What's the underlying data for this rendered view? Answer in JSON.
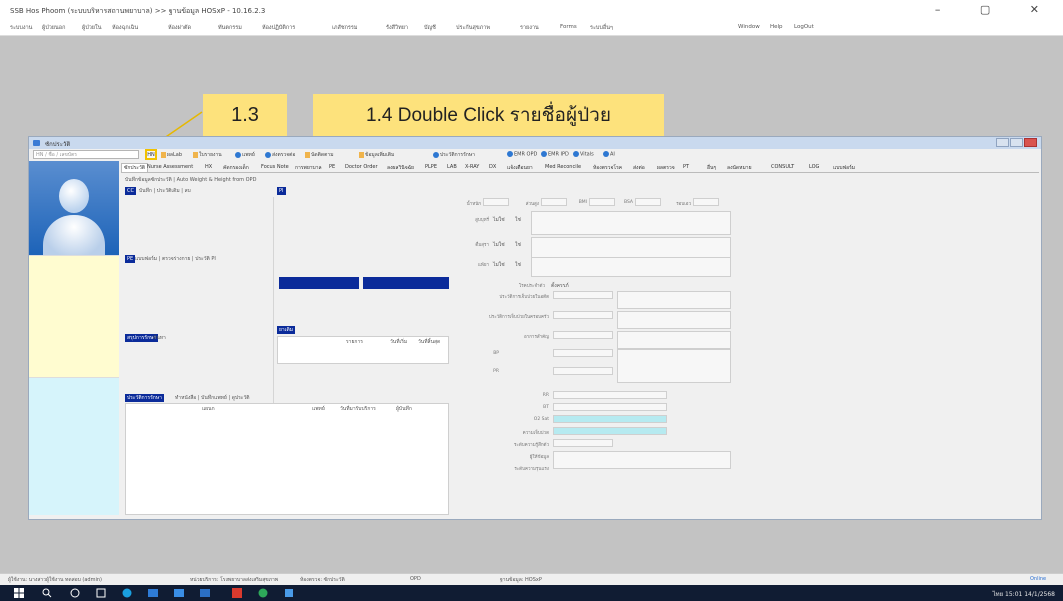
{
  "app": {
    "title": "SSB Hos Phoom (ระบบบริหารสถานพยาบาล) >> ฐานข้อมูล HOSxP - 10.16.2.3",
    "window_controls": "– ▢ ✕"
  },
  "menu": [
    "ระบบงาน",
    "ผู้ป่วยนอก",
    "ผู้ป่วยใน",
    "ห้องฉุกเฉิน",
    "ห้องผ่าตัด",
    "ทันตกรรม",
    "ห้องปฏิบัติการ",
    "เภสัชกรรม",
    "รังสีวิทยา",
    "บัญชี",
    "ประกันสุขภาพ",
    "รายงาน",
    "Forms",
    "ระบบอื่นๆ",
    "Window",
    "Help",
    "LogOut"
  ],
  "child_window": {
    "title": "ซักประวัติ",
    "search_placeholder": "HN / ชื่อ / เลขบัตร",
    "search_button": "HN",
    "toolbar_items": [
      "ผลLab",
      "ใบรายงาน",
      "แพทย์",
      "ส่งตรวจต่อ",
      "นัดติดตาม",
      "ข้อมูลเพิ่มเติม",
      "ประวัติการรักษา",
      "EMR OPD",
      "EMR IPD",
      "Vitals",
      "AI"
    ],
    "tabs": [
      "ซักประวัติ",
      "Nurse Assessment",
      "HX",
      "คัดกรองเด็ก",
      "Focus Note",
      "การพยาบาล",
      "PE",
      "Doctor Order",
      "ลงผลวินิจฉัย",
      "PLPE",
      "LAB",
      "X-RAY",
      "DX",
      "แจ้งเตือนยา",
      "Med Reconcile",
      "ห้องตรวจโรค",
      "ส่งต่อ",
      "ผลตรวจ",
      "PT",
      "อื่นๆ",
      "ลงนัดหมาย",
      "CONSULT",
      "LOG",
      "แบบฟอร์ม"
    ],
    "subtoolbar": "บันทึกข้อมูลซักประวัติ | Auto Weight & Height from OPD",
    "left_panel": {
      "btn1": "CC",
      "links1": "บันทึก | ประวัติเดิม | ลบ",
      "hpi_btn": "PI",
      "links2": "แบบฟอร์ม | ตรวจร่างกาย | ประวัติ PI",
      "pe_btn": "PE",
      "links3": "ค้นหา",
      "history_btn": "สรุปการรักษา",
      "hist_headers": [
        "รายการ",
        "วันที่เริ่ม",
        "วันที่สิ้นสุด"
      ],
      "visit_btn": "ประวัติการรักษา",
      "visit_links": "ทำหนังสือ | บันทึกแพทย์ | ดูประวัติ",
      "visit_headers": [
        "แผนก",
        "แพทย์",
        "วันที่มารับบริการ",
        "ผู้บันทึก"
      ],
      "drug_btn": "ยาเดิม"
    },
    "vitals": {
      "row1_labels": [
        "น้ำหนัก",
        "ส่วนสูง",
        "BMI",
        "BSA",
        "รอบเอว"
      ],
      "smoke": "สูบบุหรี่",
      "alcohol": "ดื่มสุรา",
      "allergy": "แพ้ยา",
      "yes": "ใช่",
      "no": "ไม่ใช่",
      "chronic": "โรคประจำตัว",
      "pregnancy": "ตั้งครรภ์",
      "labels": [
        "ประวัติการเจ็บป่วยในอดีต",
        "ประวัติการเจ็บป่วยในครอบครัว",
        "อาการสำคัญ",
        "BP",
        "PR",
        "RR",
        "BT",
        "O2 Sat",
        "ความเจ็บปวด",
        "ระดับความรู้สึกตัว",
        "ผู้ให้ข้อมูล",
        "ระดับความรุนแรง"
      ]
    }
  },
  "callouts": {
    "step_13": "1.3",
    "step_14": "1.4 Double Click รายชื่อผู้ป่วย"
  },
  "status": [
    "ผู้ใช้งาน: นางสาวผู้ใช้งาน ทดสอบ (admin)",
    "หน่วยบริการ: โรงพยาบาลส่งเสริมสุขภาพ",
    "ห้องตรวจ: ซักประวัติ",
    "OPD",
    "ฐานข้อมูล: HOSxP",
    "Online"
  ],
  "tray": "ไทย  15:01  14/1/2568"
}
